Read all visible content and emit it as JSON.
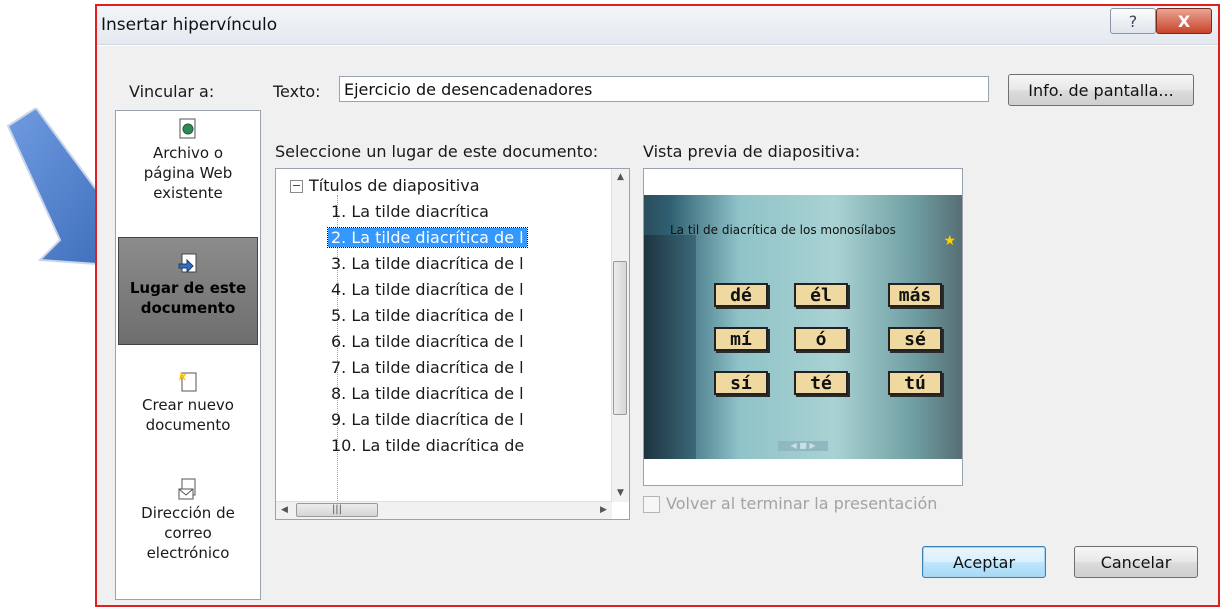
{
  "dialog": {
    "title": "Insertar hipervínculo",
    "help_label": "?",
    "close_label": "X"
  },
  "form": {
    "link_to_label": "Vincular a:",
    "text_label": "Texto:",
    "text_value": "Ejercicio de desencadenadores",
    "screentip_label": "Info. de pantalla...",
    "select_place_label": "Seleccione un lugar de este documento:",
    "preview_label": "Vista previa de diapositiva:"
  },
  "link_types": [
    {
      "line1": "Archivo o",
      "line2": "página Web",
      "line3": "existente",
      "icon": "web-file-icon"
    },
    {
      "line1": "Lugar de este",
      "line2": "documento",
      "icon": "place-in-document-icon",
      "selected": true
    },
    {
      "line1": "Crear nuevo",
      "line2": "documento",
      "icon": "new-document-icon"
    },
    {
      "line1": "Dirección de",
      "line2": "correo",
      "line3": "electrónico",
      "icon": "email-address-icon"
    }
  ],
  "tree": {
    "root": "Títulos de diapositiva",
    "items": [
      "1. La tilde diacrítica",
      "2. La tilde diacrítica de l",
      "3. La tilde diacrítica de l",
      "4. La tilde diacrítica de l",
      "5. La tilde diacrítica de l",
      "6. La tilde diacrítica de l",
      "7. La tilde diacrítica de l",
      "8. La tilde diacrítica de l",
      "9. La tilde diacrítica de l",
      "10. La tilde diacrítica de"
    ],
    "selected_index": 1
  },
  "preview": {
    "slide_title": "La til de diacrítica de los monosílabos",
    "tiles": [
      "dé",
      "él",
      "más",
      "mí",
      "ó",
      "sé",
      "sí",
      "té",
      "tú"
    ]
  },
  "checkbox": {
    "label": "Volver al terminar la presentación",
    "checked": false,
    "enabled": false
  },
  "buttons": {
    "ok": "Aceptar",
    "cancel": "Cancelar"
  },
  "colors": {
    "annotation_arrow": "#4a7cc7",
    "dialog_border": "#e02020",
    "selection": "#3399ff"
  }
}
